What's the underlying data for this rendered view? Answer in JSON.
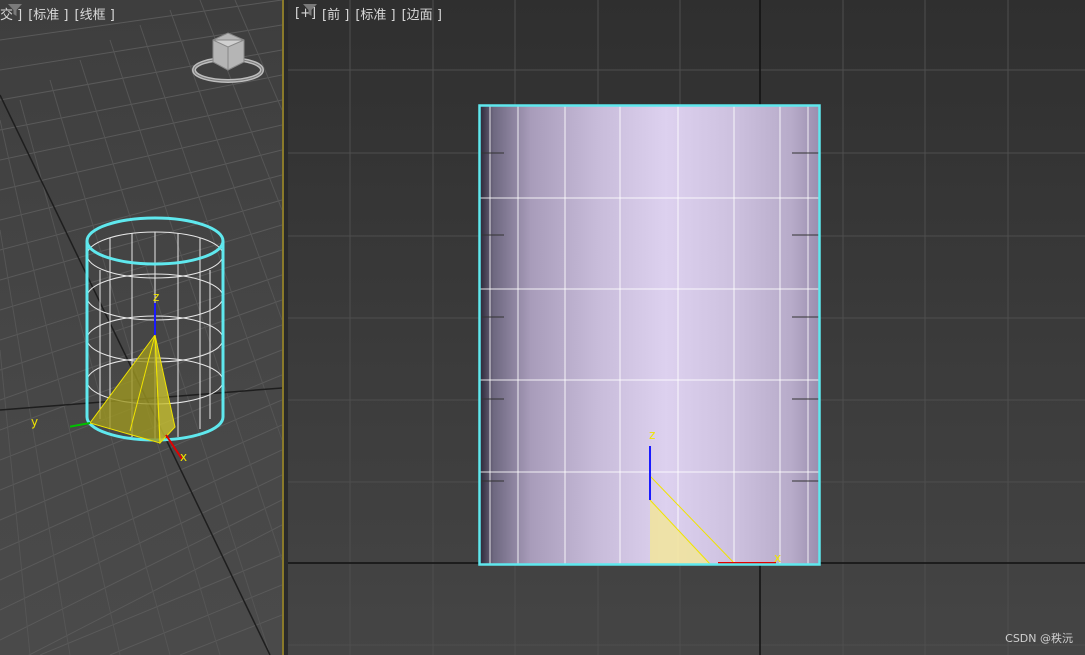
{
  "left_viewport": {
    "labels": [
      "交 ]",
      "[标准 ]",
      "[线框 ]"
    ]
  },
  "right_viewport": {
    "labels": [
      "[+]",
      "[前 ]",
      "[标准 ]",
      "[边面 ]"
    ]
  },
  "axes": {
    "z": "z",
    "x": "x",
    "y": "y"
  },
  "watermark": "CSDN @秩沅",
  "colors": {
    "selection": "#5fe8ee",
    "gizmo_yellow": "#f0e400",
    "axis_z": "#1a1aff",
    "axis_x": "#e00000",
    "axis_y": "#00c000",
    "cylinder_tint": "#d9cdeb"
  },
  "icons": [
    "filter-icon",
    "viewcube-icon",
    "gizmo-z-axis",
    "gizmo-x-axis",
    "gizmo-y-axis"
  ]
}
